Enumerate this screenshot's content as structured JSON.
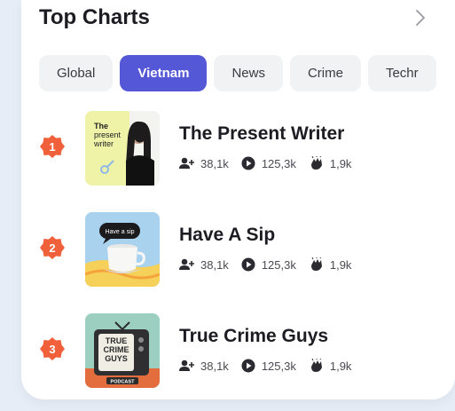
{
  "header": {
    "title": "Top Charts"
  },
  "tabs": [
    {
      "label": "Global",
      "active": false
    },
    {
      "label": "Vietnam",
      "active": true
    },
    {
      "label": "News",
      "active": false
    },
    {
      "label": "Crime",
      "active": false
    },
    {
      "label": "Techr",
      "active": false
    }
  ],
  "charts": [
    {
      "rank": "1",
      "name": "The Present Writer",
      "followers": "38,1k",
      "plays": "125,3k",
      "claps": "1,9k",
      "cover_text": "The present writer",
      "cover_icon": "portrait-cover"
    },
    {
      "rank": "2",
      "name": "Have A Sip",
      "followers": "38,1k",
      "plays": "125,3k",
      "claps": "1,9k",
      "cover_text": "Have a sip",
      "cover_icon": "cup-cover"
    },
    {
      "rank": "3",
      "name": "True Crime Guys",
      "followers": "38,1k",
      "plays": "125,3k",
      "claps": "1,9k",
      "cover_text": "TRUE CRIME GUYS",
      "cover_sub": "PODCAST",
      "cover_icon": "tv-cover"
    }
  ],
  "colors": {
    "accent": "#5458d6",
    "rank_badge": "#f0603a"
  }
}
